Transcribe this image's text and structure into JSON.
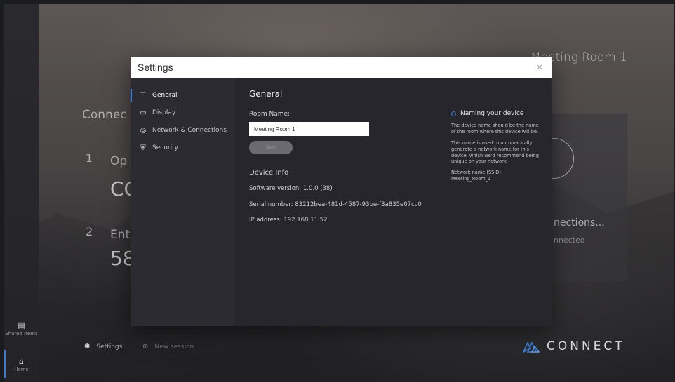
{
  "background": {
    "room_name": "Meeting Room 1",
    "connect_heading": "Connec",
    "step1_number": "1",
    "step1_text": "Op",
    "step1_code": "CC",
    "step2_number": "2",
    "step2_text": "Ent",
    "step2_code": "58",
    "connections_title": "nections...",
    "connections_status": "nnected"
  },
  "left_rail": {
    "shared_items_label": "Shared Items",
    "home_label": "Home"
  },
  "bottom_bar": {
    "settings_label": "Settings",
    "new_session_label": "New session",
    "brand": "CONNECT"
  },
  "modal": {
    "title": "Settings",
    "close_glyph": "×",
    "nav": [
      {
        "label": "General",
        "icon": "list-icon",
        "active": true
      },
      {
        "label": "Display",
        "icon": "monitor-icon",
        "active": false
      },
      {
        "label": "Network & Connections",
        "icon": "wifi-icon",
        "active": false
      },
      {
        "label": "Security",
        "icon": "shield-icon",
        "active": false
      }
    ],
    "general": {
      "section_title": "General",
      "room_name_label": "Room Name:",
      "room_name_value": "Meeting Room 1",
      "save_label": "Save",
      "device_info_title": "Device Info",
      "software_version": "Software version: 1.0.0 (38)",
      "serial_number": "Serial number: 83212bea-481d-4587-93be-f3a835e07cc0",
      "ip_address": "IP address: 192.168.11.52"
    },
    "help": {
      "title": "Naming your device",
      "p1": "The device name should be the name of the room where this device will be.",
      "p2": "This name is used to automatically generate a network name for this device; which we'd recommend being unique on your network.",
      "p3_label": "Network name (SSID):",
      "p3_value": "Meeting_Room_1"
    }
  },
  "colors": {
    "accent": "#3a7bd5",
    "modal_bg": "#26262c",
    "nav_bg": "#2b2b31",
    "header_bg": "#ffffff"
  }
}
